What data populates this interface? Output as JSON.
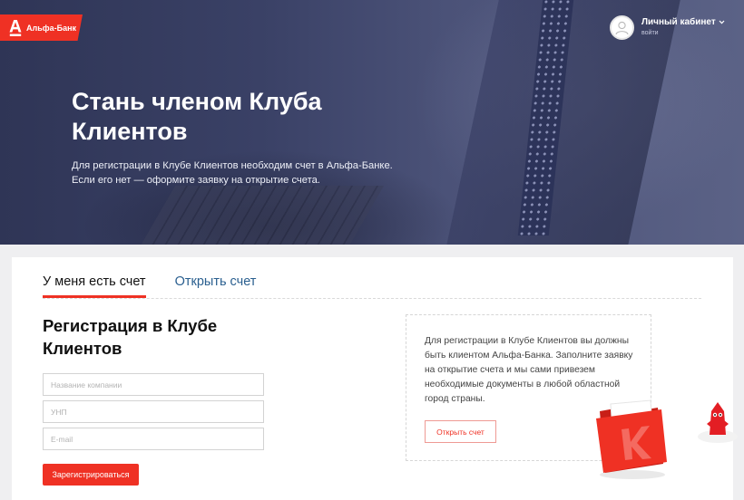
{
  "brand": {
    "name": "Альфа-Банк",
    "color": "#ef3124"
  },
  "header": {
    "cabinet_title": "Личный кабинет",
    "cabinet_sub": "войти"
  },
  "hero": {
    "title": "Стань членом Клуба Клиентов",
    "lead": "Для регистрации в Клубе Клиентов необходим счет в Альфа-Банке. Если его нет — оформите заявку на открытие счета."
  },
  "tabs": [
    {
      "label": "У меня есть счет",
      "active": true
    },
    {
      "label": "Открыть счет",
      "active": false
    }
  ],
  "form": {
    "title": "Регистрация в Клубе Клиентов",
    "company_placeholder": "Название компании",
    "unp_placeholder": "УНП",
    "email_placeholder": "E-mail",
    "submit_label": "Зарегистрироваться"
  },
  "info": {
    "text": "Для регистрации в Клубе Клиентов вы должны быть клиентом Альфа-Банка. Заполните заявку на открытие счета и мы сами привезем необходимые документы в любой областной город страны.",
    "button_label": "Открыть счет"
  },
  "icons": {
    "logo": "alfa-a-icon",
    "avatar": "user-avatar-icon",
    "chevron": "chevron-down-icon",
    "folder": "folder-icon",
    "mascot": "mascot-icon"
  }
}
